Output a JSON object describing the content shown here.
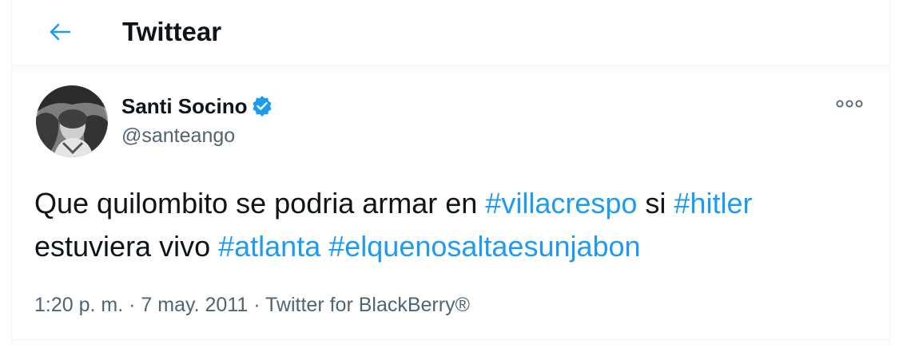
{
  "header": {
    "title": "Twittear",
    "back_icon": "arrow-left-icon"
  },
  "colors": {
    "accent": "#1d9bf0",
    "text_primary": "#0f1419",
    "text_secondary": "#536471",
    "divider": "#eff3f4"
  },
  "tweet": {
    "author": {
      "display_name": "Santi Socino",
      "handle": "@santeango",
      "verified": true,
      "verified_icon": "verified-badge-icon"
    },
    "more_icon": "more-options-icon",
    "text_parts": [
      {
        "text": "Que quilombito se podria armar en ",
        "type": "plain"
      },
      {
        "text": "#villacrespo",
        "type": "hashtag"
      },
      {
        "text": " si ",
        "type": "plain"
      },
      {
        "text": "#hitler",
        "type": "hashtag"
      },
      {
        "text": " estuviera vivo ",
        "type": "plain"
      },
      {
        "text": "#atlanta",
        "type": "hashtag"
      },
      {
        "text": " ",
        "type": "plain"
      },
      {
        "text": "#elquenosaltaesunjabon",
        "type": "hashtag"
      }
    ],
    "meta": {
      "time": "1:20 p. m.",
      "separator_1": " · ",
      "date": "7 may. 2011",
      "separator_2": " · ",
      "source": "Twitter for BlackBerry®"
    }
  }
}
